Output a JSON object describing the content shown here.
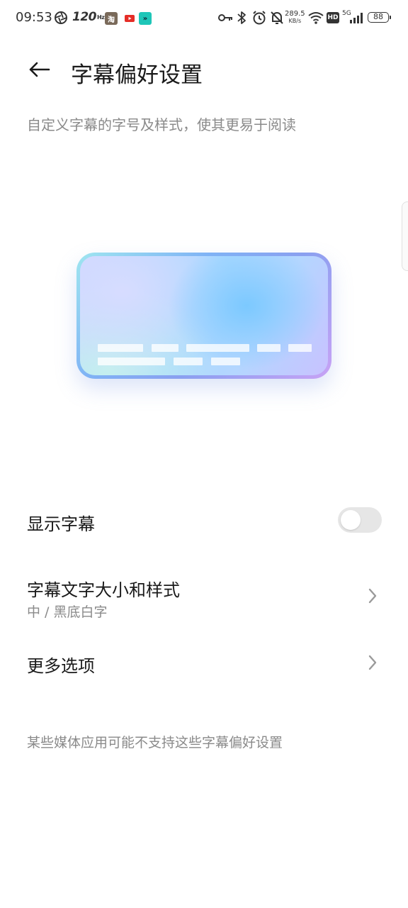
{
  "status_bar": {
    "time": "09:53",
    "refresh_rate": "120",
    "refresh_unit": "Hz",
    "net_speed_value": "289.5",
    "net_speed_unit": "KB/s",
    "hd_label": "HD",
    "network": "5G",
    "battery": "88",
    "icons": [
      "shutter-icon",
      "taobao-app-icon",
      "youtube-app-icon",
      "cast-app-icon",
      "key-icon",
      "bluetooth-icon",
      "alarm-icon",
      "mute-bell-icon",
      "wifi-icon",
      "signal-icon"
    ],
    "colors": {
      "youtube": "#e52d27",
      "cast_app": "#1ec6b8",
      "taobao": "#7a6a5a"
    }
  },
  "header": {
    "title": "字幕偏好设置",
    "back_icon": "back-arrow-icon"
  },
  "subtitle": "自定义字幕的字号及样式，使其更易于阅读",
  "settings": {
    "show_captions": {
      "label": "显示字幕",
      "enabled": false
    },
    "caption_style": {
      "label": "字幕文字大小和样式",
      "value": "中 / 黑底白字"
    },
    "more_options": {
      "label": "更多选项"
    }
  },
  "footnote": "某些媒体应用可能不支持这些字幕偏好设置"
}
